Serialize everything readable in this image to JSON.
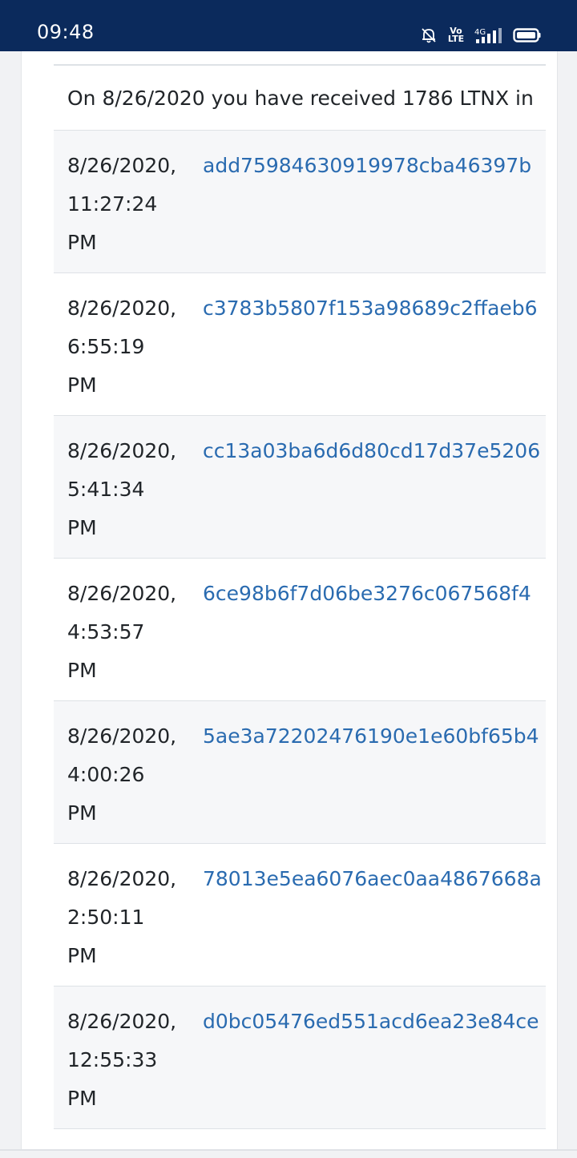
{
  "status_bar": {
    "time": "09:48",
    "icons": [
      "mute-bell-icon",
      "volte-icon",
      "4g-signal-icon",
      "battery-icon"
    ],
    "volte_text": "Vo LTE",
    "network_label": "4G",
    "background": "#0b2a5c"
  },
  "summary": {
    "text": "On 8/26/2020 you have received 1786 LTNX in"
  },
  "transactions": [
    {
      "date": "8/26/2020,",
      "time": "11:27:24",
      "ampm": "PM",
      "hash": "add75984630919978cba46397b"
    },
    {
      "date": "8/26/2020,",
      "time": "6:55:19",
      "ampm": "PM",
      "hash": "c3783b5807f153a98689c2ffaeb6"
    },
    {
      "date": "8/26/2020,",
      "time": "5:41:34",
      "ampm": "PM",
      "hash": "cc13a03ba6d6d80cd17d37e5206"
    },
    {
      "date": "8/26/2020,",
      "time": "4:53:57",
      "ampm": "PM",
      "hash": "6ce98b6f7d06be3276c067568f4"
    },
    {
      "date": "8/26/2020,",
      "time": "4:00:26",
      "ampm": "PM",
      "hash": "5ae3a72202476190e1e60bf65b4"
    },
    {
      "date": "8/26/2020,",
      "time": "2:50:11",
      "ampm": "PM",
      "hash": "78013e5ea6076aec0aa4867668a"
    },
    {
      "date": "8/26/2020,",
      "time": "12:55:33",
      "ampm": "PM",
      "hash": "d0bc05476ed551acd6ea23e84ce"
    }
  ],
  "colors": {
    "link": "#2a6bb0",
    "text": "#212529",
    "stripe": "#f6f7f9"
  }
}
